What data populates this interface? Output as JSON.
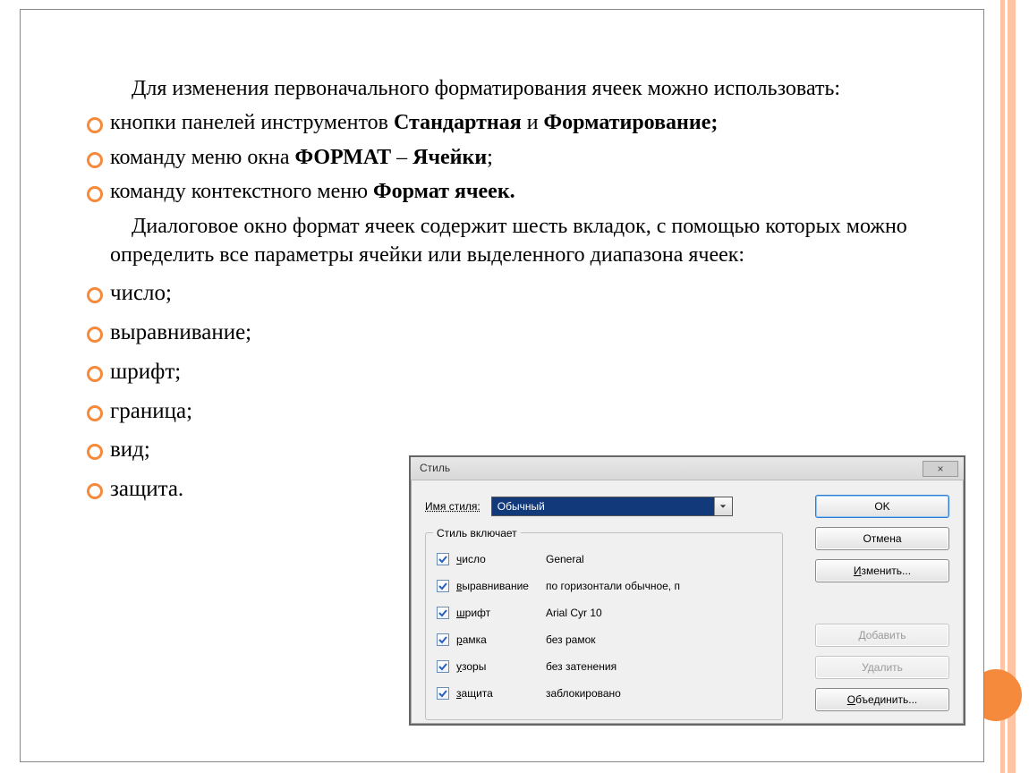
{
  "slide": {
    "intro": "Для изменения первоначального форматирования ячеек можно использовать:",
    "bullets_top": [
      {
        "pre": "кнопки панелей инструментов ",
        "b1": "Стандартная",
        "mid": " и ",
        "b2": "Форматирование;",
        "post": ""
      },
      {
        "pre": "команду меню окна ",
        "b1": "ФОРМАТ",
        "mid": " – ",
        "b2": "Ячейки",
        "post": ";"
      },
      {
        "pre": "команду контекстного меню ",
        "b1": "Формат ячеек.",
        "mid": "",
        "b2": "",
        "post": ""
      }
    ],
    "mid_para": "Диалоговое окно формат ячеек содержит шесть вкладок, с помощью которых можно определить все параметры ячейки или выделенного диапазона ячеек:",
    "bullets_bottom": [
      "число;",
      "выравнивание;",
      "шрифт;",
      "граница;",
      "вид;",
      "защита."
    ]
  },
  "dialog": {
    "title": "Стиль",
    "close_glyph": "×",
    "name_label": "Имя стиля:",
    "name_value": "Обычный",
    "group_title": "Стиль включает",
    "options": [
      {
        "u": "ч",
        "rest": "исло",
        "value": "General"
      },
      {
        "u": "в",
        "rest": "ыравнивание",
        "value": "по горизонтали обычное, п"
      },
      {
        "u": "ш",
        "rest": "рифт",
        "value": "Arial Cyr 10"
      },
      {
        "u": "р",
        "rest": "амка",
        "value": "без рамок"
      },
      {
        "u": "у",
        "rest": "зоры",
        "value": "без затенения"
      },
      {
        "u": "з",
        "rest": "ащита",
        "value": "заблокировано"
      }
    ],
    "buttons": {
      "ok": "OK",
      "cancel": "Отмена",
      "modify_u": "И",
      "modify_rest": "зменить...",
      "add": "Добавить",
      "delete": "Удалить",
      "merge_u": "О",
      "merge_rest": "бъединить..."
    }
  }
}
